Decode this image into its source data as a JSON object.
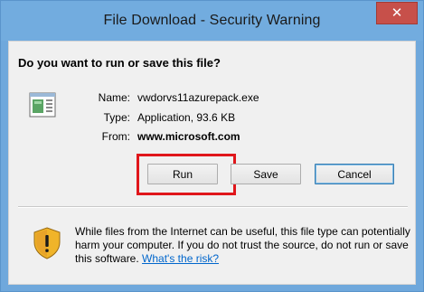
{
  "window": {
    "title": "File Download - Security Warning",
    "close_glyph": "✕"
  },
  "question": "Do you want to run or save this file?",
  "file": {
    "icon": "application-icon",
    "name_label": "Name:",
    "name_value": "vwdorvs11azurepack.exe",
    "type_label": "Type:",
    "type_value": "Application, 93.6 KB",
    "from_label": "From:",
    "from_value": "www.microsoft.com"
  },
  "buttons": {
    "run": "Run",
    "save": "Save",
    "cancel": "Cancel"
  },
  "warning": {
    "icon": "shield-icon",
    "text": "While files from the Internet can be useful, this file type can potentially harm your computer. If you do not trust the source, do not run or save this software.",
    "link": "What's the risk?"
  },
  "colors": {
    "titlebar": "#72acdf",
    "close": "#c7504a",
    "highlight": "#e0161b",
    "link": "#0066cc"
  }
}
